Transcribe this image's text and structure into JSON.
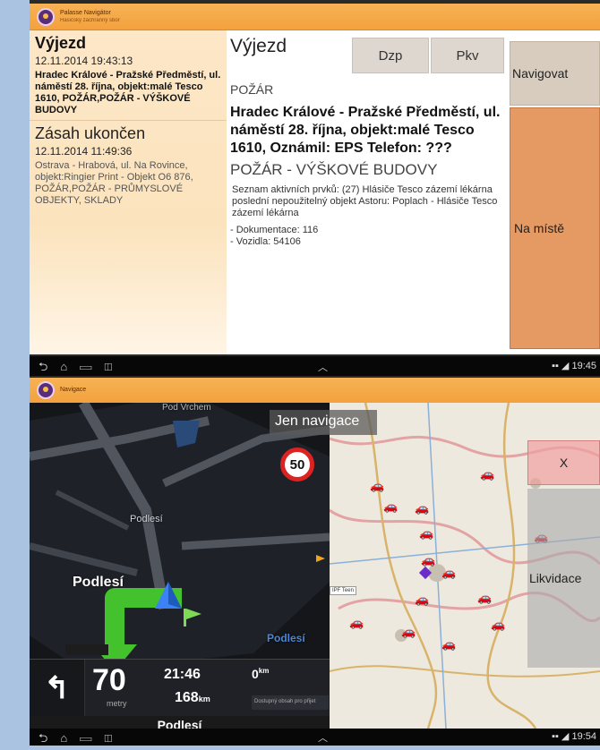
{
  "app1": {
    "title_line1": "Palasse Navigátor",
    "title_line2": "Hasičský záchranný sbor",
    "list": [
      {
        "heading": "Výjezd",
        "time": "12.11.2014 19:43:13",
        "desc": "Hradec Králové - Pražské Předměstí, ul. náměstí 28. října, objekt:malé Tesco 1610, POŽÁR,POŽÁR - VÝŠKOVÉ BUDOVY"
      },
      {
        "heading": "Zásah ukončen",
        "time": "12.11.2014 11:49:36",
        "desc": "Ostrava - Hrabová, ul. Na Rovince, objekt:Ringier Print - Objekt O6 876, POŽÁR,POŽÁR - PRŮMYSLOVÉ OBJEKTY, SKLADY"
      }
    ],
    "detail": {
      "title": "Výjezd",
      "tab_dzp": "Dzp",
      "tab_pkv": "Pkv",
      "category": "POŽÁR",
      "address": "Hradec Králové - Pražské Předměstí, ul. náměstí 28. října, objekt:malé Tesco 1610, Oznámil: EPS   Telefon: ???",
      "subtype": "POŽÁR - VÝŠKOVÉ BUDOVY",
      "note": "Seznam aktivních prvků: (27) Hlásiče Tesco zázemí lékárna  poslední nepoužitelný objekt Astoru: Poplach - Hlásiče Tesco zázemí lékárna",
      "doc": "- Dokumentace: 116",
      "vehicles": "- Vozidla: 54106"
    },
    "btn_navigate": "Navigovat",
    "btn_onsite": "Na místě"
  },
  "status1": {
    "time": "19:45"
  },
  "app2": {
    "title": "Navigace",
    "street_top": "Pod Vrchem",
    "street_place": "Podlesí",
    "street_left": "Podlesí",
    "street_right": "Podlesí",
    "street_bottom": "Podlesí",
    "jen_navigace": "Jen navigace",
    "speed_limit": "50",
    "dist_value": "70",
    "dist_unit": "metry",
    "eta": "21:46",
    "remaining_km": "168",
    "remaining_unit": "km",
    "distance_next": "0",
    "distance_next_unit": "km",
    "small_note": "Dostupný obsah pro přijet",
    "btn_x": "X",
    "btn_likvidace": "Likvidace",
    "map_label": "IPF Teen"
  },
  "status2": {
    "time": "19:54"
  }
}
